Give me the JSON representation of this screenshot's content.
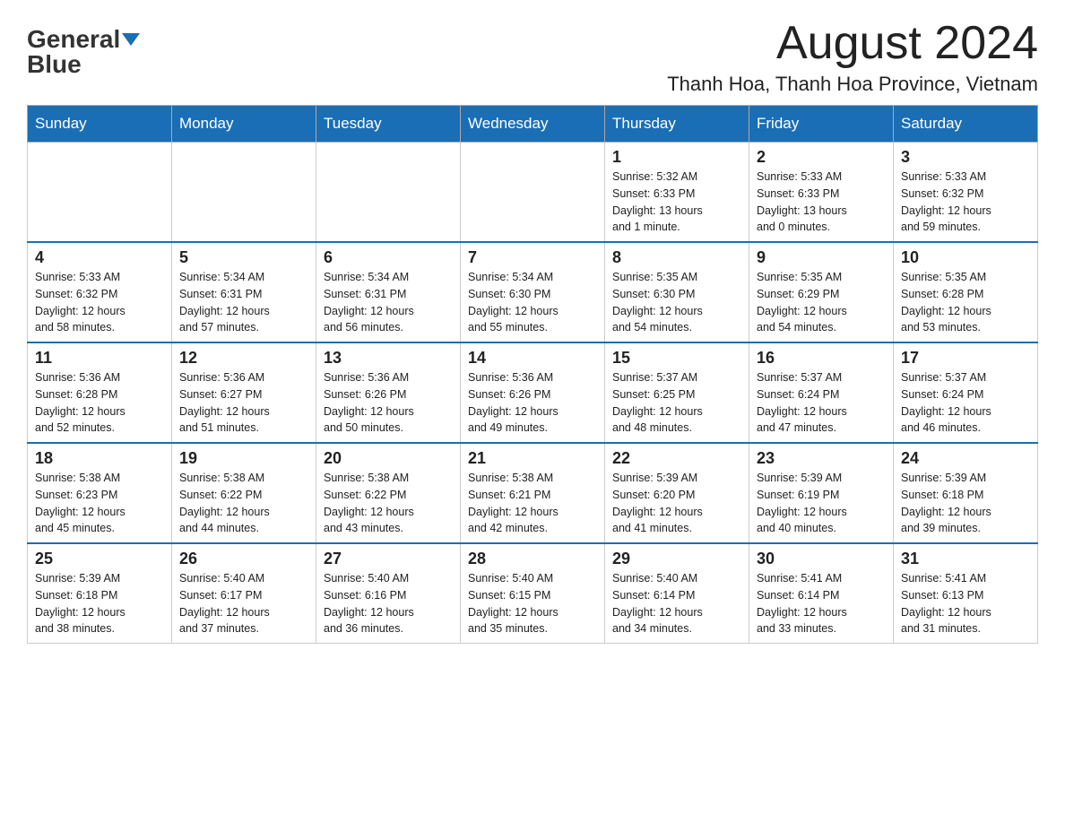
{
  "header": {
    "logo": {
      "general": "General",
      "blue": "Blue"
    },
    "month_year": "August 2024",
    "location": "Thanh Hoa, Thanh Hoa Province, Vietnam"
  },
  "weekdays": [
    "Sunday",
    "Monday",
    "Tuesday",
    "Wednesday",
    "Thursday",
    "Friday",
    "Saturday"
  ],
  "rows": [
    {
      "cells": [
        {
          "day": "",
          "info": ""
        },
        {
          "day": "",
          "info": ""
        },
        {
          "day": "",
          "info": ""
        },
        {
          "day": "",
          "info": ""
        },
        {
          "day": "1",
          "info": "Sunrise: 5:32 AM\nSunset: 6:33 PM\nDaylight: 13 hours\nand 1 minute."
        },
        {
          "day": "2",
          "info": "Sunrise: 5:33 AM\nSunset: 6:33 PM\nDaylight: 13 hours\nand 0 minutes."
        },
        {
          "day": "3",
          "info": "Sunrise: 5:33 AM\nSunset: 6:32 PM\nDaylight: 12 hours\nand 59 minutes."
        }
      ]
    },
    {
      "cells": [
        {
          "day": "4",
          "info": "Sunrise: 5:33 AM\nSunset: 6:32 PM\nDaylight: 12 hours\nand 58 minutes."
        },
        {
          "day": "5",
          "info": "Sunrise: 5:34 AM\nSunset: 6:31 PM\nDaylight: 12 hours\nand 57 minutes."
        },
        {
          "day": "6",
          "info": "Sunrise: 5:34 AM\nSunset: 6:31 PM\nDaylight: 12 hours\nand 56 minutes."
        },
        {
          "day": "7",
          "info": "Sunrise: 5:34 AM\nSunset: 6:30 PM\nDaylight: 12 hours\nand 55 minutes."
        },
        {
          "day": "8",
          "info": "Sunrise: 5:35 AM\nSunset: 6:30 PM\nDaylight: 12 hours\nand 54 minutes."
        },
        {
          "day": "9",
          "info": "Sunrise: 5:35 AM\nSunset: 6:29 PM\nDaylight: 12 hours\nand 54 minutes."
        },
        {
          "day": "10",
          "info": "Sunrise: 5:35 AM\nSunset: 6:28 PM\nDaylight: 12 hours\nand 53 minutes."
        }
      ]
    },
    {
      "cells": [
        {
          "day": "11",
          "info": "Sunrise: 5:36 AM\nSunset: 6:28 PM\nDaylight: 12 hours\nand 52 minutes."
        },
        {
          "day": "12",
          "info": "Sunrise: 5:36 AM\nSunset: 6:27 PM\nDaylight: 12 hours\nand 51 minutes."
        },
        {
          "day": "13",
          "info": "Sunrise: 5:36 AM\nSunset: 6:26 PM\nDaylight: 12 hours\nand 50 minutes."
        },
        {
          "day": "14",
          "info": "Sunrise: 5:36 AM\nSunset: 6:26 PM\nDaylight: 12 hours\nand 49 minutes."
        },
        {
          "day": "15",
          "info": "Sunrise: 5:37 AM\nSunset: 6:25 PM\nDaylight: 12 hours\nand 48 minutes."
        },
        {
          "day": "16",
          "info": "Sunrise: 5:37 AM\nSunset: 6:24 PM\nDaylight: 12 hours\nand 47 minutes."
        },
        {
          "day": "17",
          "info": "Sunrise: 5:37 AM\nSunset: 6:24 PM\nDaylight: 12 hours\nand 46 minutes."
        }
      ]
    },
    {
      "cells": [
        {
          "day": "18",
          "info": "Sunrise: 5:38 AM\nSunset: 6:23 PM\nDaylight: 12 hours\nand 45 minutes."
        },
        {
          "day": "19",
          "info": "Sunrise: 5:38 AM\nSunset: 6:22 PM\nDaylight: 12 hours\nand 44 minutes."
        },
        {
          "day": "20",
          "info": "Sunrise: 5:38 AM\nSunset: 6:22 PM\nDaylight: 12 hours\nand 43 minutes."
        },
        {
          "day": "21",
          "info": "Sunrise: 5:38 AM\nSunset: 6:21 PM\nDaylight: 12 hours\nand 42 minutes."
        },
        {
          "day": "22",
          "info": "Sunrise: 5:39 AM\nSunset: 6:20 PM\nDaylight: 12 hours\nand 41 minutes."
        },
        {
          "day": "23",
          "info": "Sunrise: 5:39 AM\nSunset: 6:19 PM\nDaylight: 12 hours\nand 40 minutes."
        },
        {
          "day": "24",
          "info": "Sunrise: 5:39 AM\nSunset: 6:18 PM\nDaylight: 12 hours\nand 39 minutes."
        }
      ]
    },
    {
      "cells": [
        {
          "day": "25",
          "info": "Sunrise: 5:39 AM\nSunset: 6:18 PM\nDaylight: 12 hours\nand 38 minutes."
        },
        {
          "day": "26",
          "info": "Sunrise: 5:40 AM\nSunset: 6:17 PM\nDaylight: 12 hours\nand 37 minutes."
        },
        {
          "day": "27",
          "info": "Sunrise: 5:40 AM\nSunset: 6:16 PM\nDaylight: 12 hours\nand 36 minutes."
        },
        {
          "day": "28",
          "info": "Sunrise: 5:40 AM\nSunset: 6:15 PM\nDaylight: 12 hours\nand 35 minutes."
        },
        {
          "day": "29",
          "info": "Sunrise: 5:40 AM\nSunset: 6:14 PM\nDaylight: 12 hours\nand 34 minutes."
        },
        {
          "day": "30",
          "info": "Sunrise: 5:41 AM\nSunset: 6:14 PM\nDaylight: 12 hours\nand 33 minutes."
        },
        {
          "day": "31",
          "info": "Sunrise: 5:41 AM\nSunset: 6:13 PM\nDaylight: 12 hours\nand 31 minutes."
        }
      ]
    }
  ]
}
